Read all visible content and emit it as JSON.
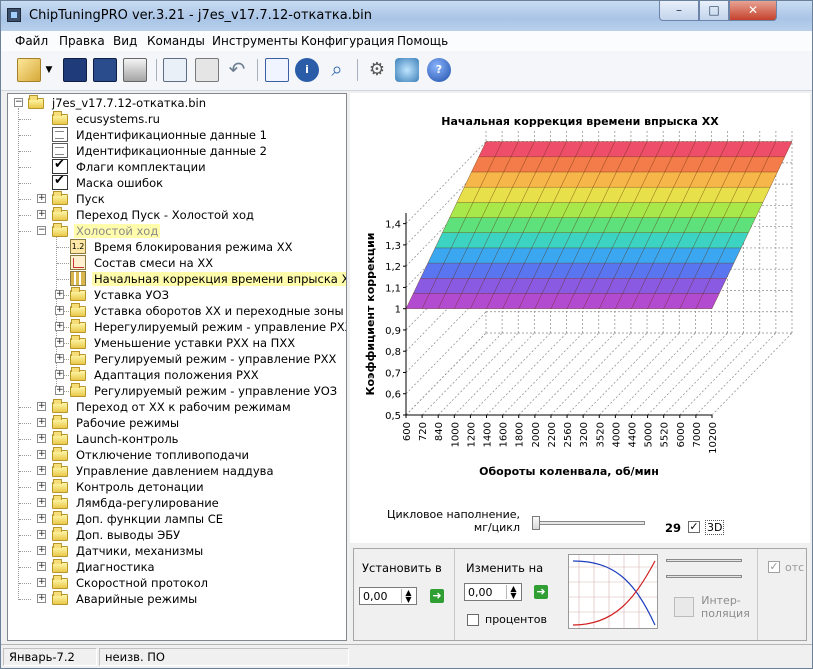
{
  "window": {
    "title": "ChipTuningPRO ver.3.21 - j7es_v17.7.12-откатка.bin"
  },
  "menu": [
    "Файл",
    "Правка",
    "Вид",
    "Команды",
    "Инструменты",
    "Конфигурация",
    "Помощь"
  ],
  "toolbar_icons": [
    "open-icon",
    "dropdown-arrow-icon",
    "save-icon",
    "save-as-icon",
    "print-icon",
    "copy-icon",
    "paste-icon",
    "undo-icon",
    "report-icon",
    "info-icon",
    "search-icon",
    "settings-tools-icon",
    "connect-icon",
    "help-icon"
  ],
  "tree": {
    "root": "j7es_v17.7.12-откатка.bin",
    "items": [
      "ecusystems.ru",
      "Идентификационные данные 1",
      "Идентификационные данные 2",
      "Флаги комплектации",
      "Маска ошибок",
      "Пуск",
      "Переход Пуск - Холостой ход",
      "Холостой ход",
      "Время блокирования режима ХХ",
      "Состав смеси на ХХ",
      "Начальная коррекция времени впрыска ХХ",
      "Уставка УОЗ",
      "Уставка оборотов ХХ и переходные зоны",
      "Нерегулируемый режим - управление РХХ",
      "Уменьшение уставки РХХ на ПХХ",
      "Регулируемый режим - управление РХХ",
      "Адаптация положения  РХХ",
      "Регулируемый режим - управление УОЗ",
      "Переход от ХХ к рабочим режимам",
      "Рабочие режимы",
      "Launch-контроль",
      "Отключение топливоподачи",
      "Управление давлением наддува",
      "Контроль детонации",
      "Лямбда-регулирование",
      "Доп. функции лампы CE",
      "Доп. выводы ЭБУ",
      "Датчики, механизмы",
      "Диагностика",
      "Скоростной протокол",
      "Аварийные режимы"
    ],
    "number_icon_text": "1.2"
  },
  "chart_data": {
    "type": "surface3d",
    "title": "Начальная коррекция времени впрыска ХХ",
    "xlabel": "Обороты коленвала, об/мин",
    "ylabel": "Коэффициент коррекции",
    "x": [
      "600",
      "720",
      "840",
      "1000",
      "1200",
      "1400",
      "1600",
      "1800",
      "2000",
      "2200",
      "2560",
      "3200",
      "3520",
      "4000",
      "4400",
      "5000",
      "5520",
      "6000",
      "7000",
      "10200"
    ],
    "yticks": [
      "0,5",
      "0,6",
      "0,7",
      "0,8",
      "0,9",
      "1",
      "1,1",
      "1,2",
      "1,3",
      "1,4"
    ],
    "ylim": [
      0.5,
      1.45
    ],
    "surface_values": [
      1.0,
      1.4
    ],
    "grid": true
  },
  "controls": {
    "cycle_label_1": "Цикловое наполнение,",
    "cycle_label_2": "мг/цикл",
    "cycle_value": "29",
    "mode_3d_label": "3D",
    "set_label": "Установить в",
    "set_value": "0,00",
    "change_label": "Изменить на",
    "change_value": "0,00",
    "percent_label": "процентов",
    "interp_label_1": "Интер-",
    "interp_label_2": "поляция",
    "cut_label": "отс"
  },
  "status": [
    "Январь-7.2",
    "неизв. ПО"
  ]
}
